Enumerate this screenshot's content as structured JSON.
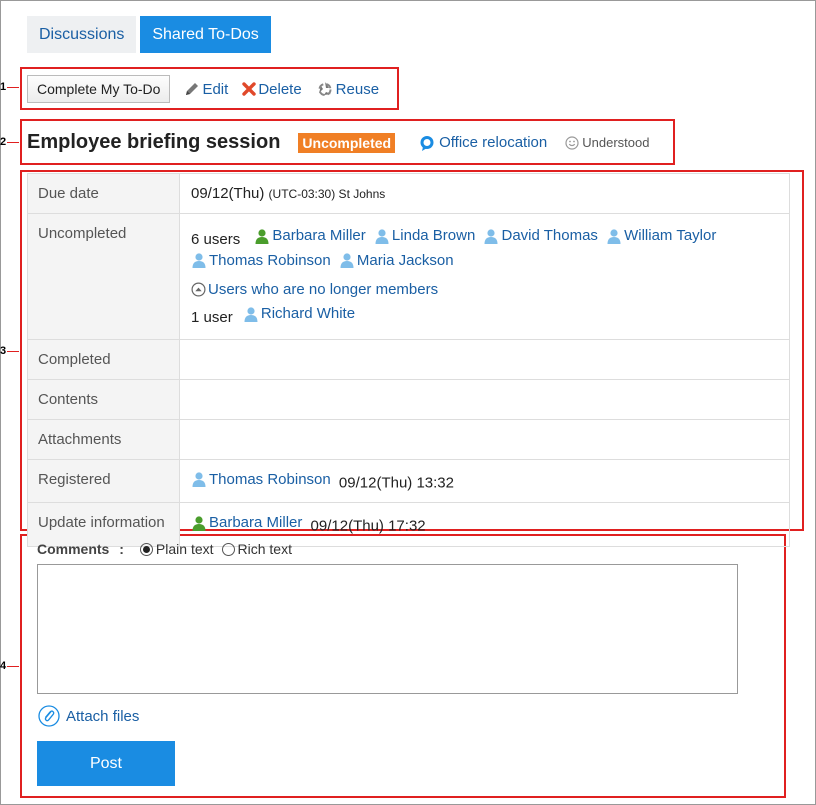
{
  "tabs": [
    {
      "label": "Discussions"
    },
    {
      "label": "Shared To-Dos"
    }
  ],
  "markers": [
    "1",
    "2",
    "3",
    "4"
  ],
  "toolbar": {
    "complete_label": "Complete My To-Do",
    "edit_label": "Edit",
    "delete_label": "Delete",
    "reuse_label": "Reuse"
  },
  "todo": {
    "title": "Employee briefing session",
    "status_badge": "Uncompleted",
    "category": "Office relocation",
    "understood": "Understood"
  },
  "details": {
    "due_date": {
      "label": "Due date",
      "value": "09/12(Thu)",
      "tz": "(UTC-03:30) St Johns"
    },
    "uncompleted": {
      "label": "Uncompleted",
      "count": "6 users",
      "users": [
        "Barbara Miller",
        "Linda Brown",
        "David Thomas",
        "William Taylor",
        "Thomas Robinson",
        "Maria Jackson"
      ],
      "former_members_link": "Users who are no longer members",
      "former_count": "1 user",
      "former_users": [
        "Richard White"
      ]
    },
    "completed": {
      "label": "Completed"
    },
    "contents": {
      "label": "Contents"
    },
    "attachments": {
      "label": "Attachments"
    },
    "registered": {
      "label": "Registered",
      "user": "Thomas Robinson",
      "time": "09/12(Thu) 13:32"
    },
    "update_info": {
      "label": "Update information",
      "user": "Barbara Miller",
      "time": "09/12(Thu) 17:32"
    }
  },
  "comment_form": {
    "label": "Comments",
    "colon": ":",
    "plain_text": "Plain text",
    "rich_text": "Rich text",
    "attach_label": "Attach files",
    "post_label": "Post"
  },
  "colors": {
    "accent": "#1a8ce2",
    "link": "#1a5fa4",
    "badge": "#f07f25",
    "annotation": "#e02020"
  }
}
